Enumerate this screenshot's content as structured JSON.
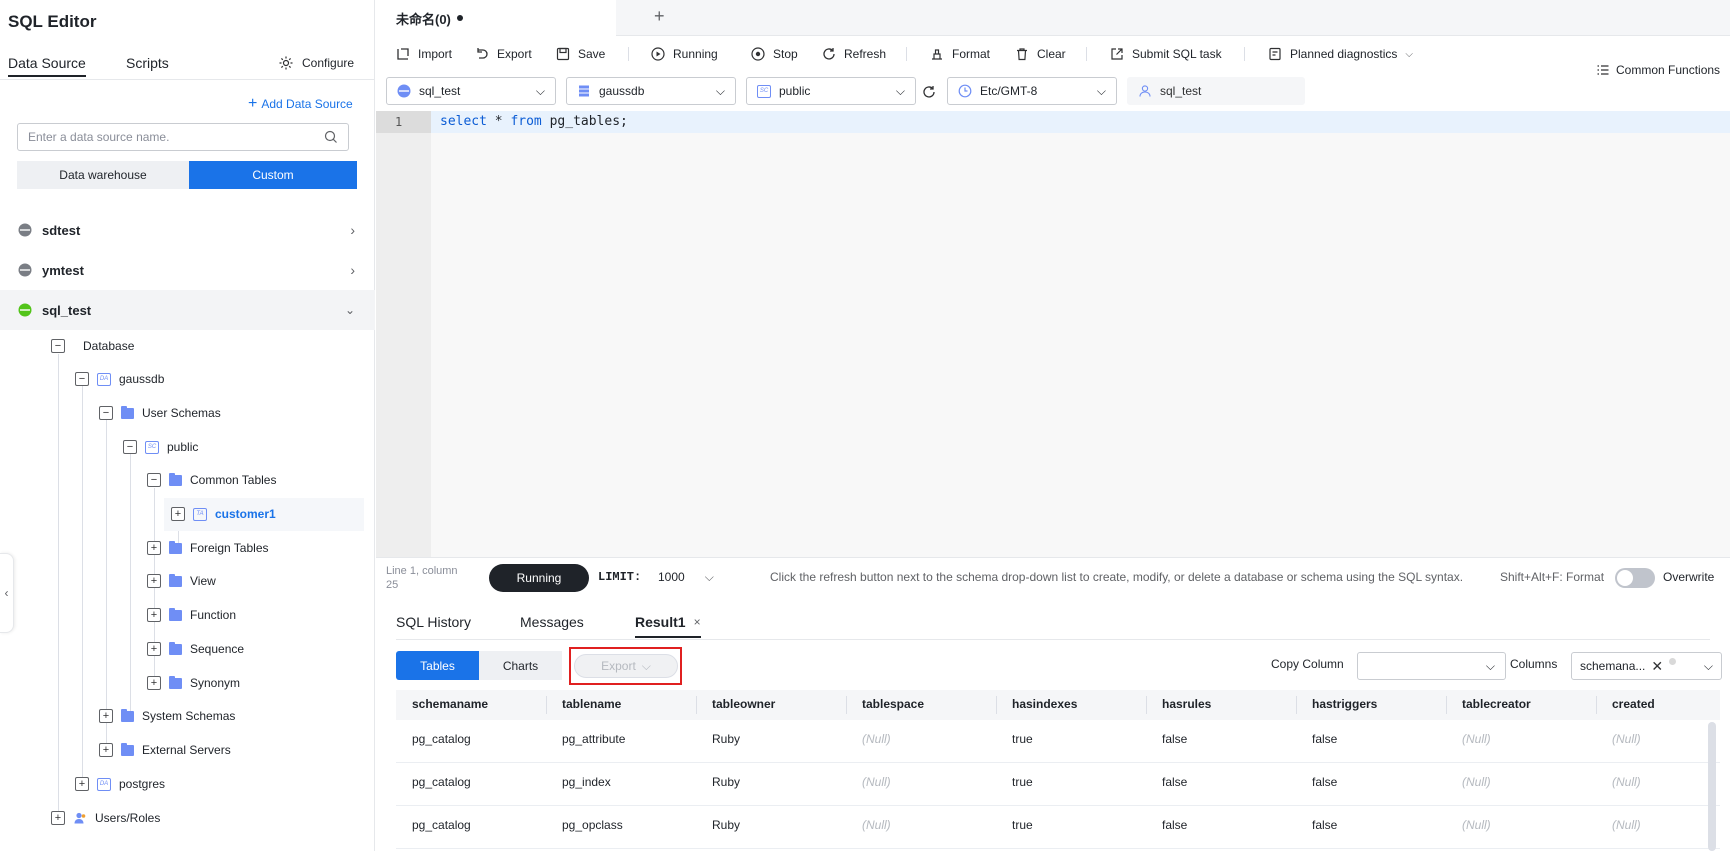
{
  "sidebar": {
    "title": "SQL Editor",
    "tabs": [
      "Data Source",
      "Scripts"
    ],
    "configure_label": "Configure",
    "add_data_source": "Add Data Source",
    "search_placeholder": "Enter a data source name.",
    "segment": [
      "Data warehouse",
      "Custom"
    ],
    "data_sources": [
      "sdtest",
      "ymtest",
      "sql_test"
    ],
    "tree": {
      "database": "Database",
      "gaussdb": "gaussdb",
      "user_schemas": "User Schemas",
      "public": "public",
      "common_tables": "Common Tables",
      "customer1": "customer1",
      "foreign_tables": "Foreign Tables",
      "view": "View",
      "function": "Function",
      "sequence": "Sequence",
      "synonym": "Synonym",
      "system_schemas": "System Schemas",
      "external_servers": "External Servers",
      "postgres": "postgres",
      "users_roles": "Users/Roles",
      "icon_da": "DA",
      "icon_sc": "SC",
      "icon_ta": "TA"
    }
  },
  "editor": {
    "tab_title": "未命名(0)",
    "toolbar": {
      "import": "Import",
      "export": "Export",
      "save": "Save",
      "running": "Running",
      "stop": "Stop",
      "refresh": "Refresh",
      "format": "Format",
      "clear": "Clear",
      "submit": "Submit SQL task",
      "planned": "Planned diagnostics",
      "common_functions": "Common Functions"
    },
    "selectors": {
      "datasource": "sql_test",
      "database": "gaussdb",
      "schema": "public",
      "timezone": "Etc/GMT-8",
      "user": "sql_test"
    },
    "line_number": "1",
    "code": {
      "kw1": "select",
      "star": " * ",
      "kw2": "from",
      "rest": " pg_tables;"
    },
    "status": {
      "position_line1": "Line 1, column",
      "position_line2": "25",
      "run_button": "Running",
      "limit_label": "LIMIT:",
      "limit_value": "1000",
      "hint": "Click the refresh button next to the schema drop-down list to create, modify, or delete a database or schema using the SQL syntax.",
      "shortcut": "Shift+Alt+F: Format",
      "overwrite": "Overwrite"
    }
  },
  "results": {
    "tabs": [
      "SQL History",
      "Messages",
      "Result1"
    ],
    "subtabs": [
      "Tables",
      "Charts"
    ],
    "export_label": "Export",
    "copy_column_label": "Copy Column",
    "columns_label": "Columns",
    "columns_value": "schemana...",
    "headers": [
      "schemaname",
      "tablename",
      "tableowner",
      "tablespace",
      "hasindexes",
      "hasrules",
      "hastriggers",
      "tablecreator",
      "created"
    ],
    "rows": [
      [
        "pg_catalog",
        "pg_attribute",
        "Ruby",
        "(Null)",
        "true",
        "false",
        "false",
        "(Null)",
        "(Null)"
      ],
      [
        "pg_catalog",
        "pg_index",
        "Ruby",
        "(Null)",
        "true",
        "false",
        "false",
        "(Null)",
        "(Null)"
      ],
      [
        "pg_catalog",
        "pg_opclass",
        "Ruby",
        "(Null)",
        "true",
        "false",
        "false",
        "(Null)",
        "(Null)"
      ]
    ]
  }
}
